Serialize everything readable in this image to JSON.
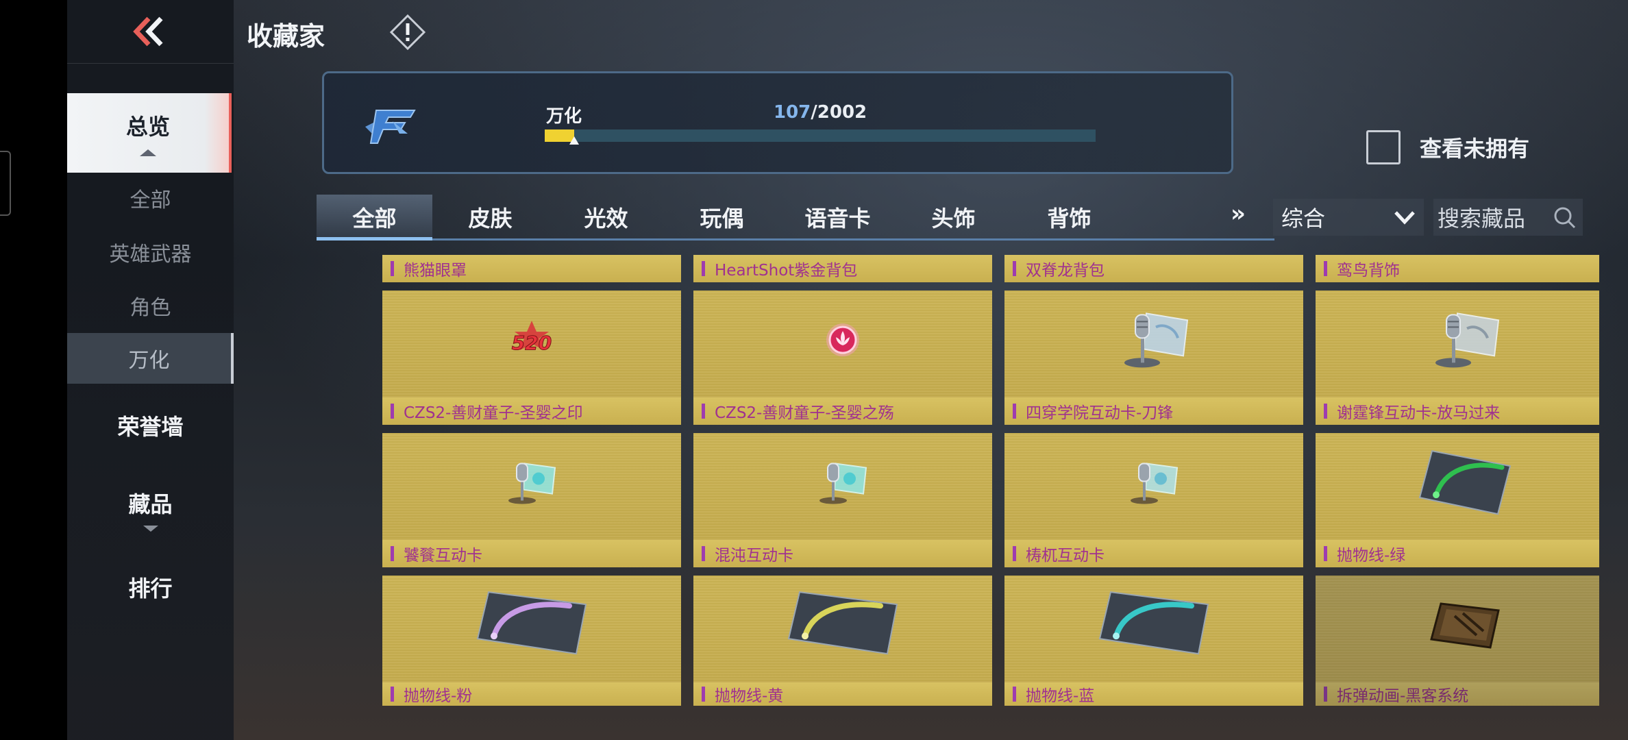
{
  "header": {
    "title": "收藏家"
  },
  "sidebar": {
    "items": [
      {
        "label": "总览"
      },
      {
        "label": "全部"
      },
      {
        "label": "英雄武器"
      },
      {
        "label": "角色"
      },
      {
        "label": "万化"
      },
      {
        "label": "荣誉墙"
      },
      {
        "label": "藏品"
      },
      {
        "label": "排行"
      }
    ]
  },
  "progress": {
    "name": "万化",
    "current": "107",
    "total": "/2002",
    "fraction": 0.053
  },
  "owned_filter": {
    "label": "查看未拥有",
    "checked": false
  },
  "tabs": [
    {
      "label": "全部"
    },
    {
      "label": "皮肤"
    },
    {
      "label": "光效"
    },
    {
      "label": "玩偶"
    },
    {
      "label": "语音卡"
    },
    {
      "label": "头饰"
    },
    {
      "label": "背饰"
    }
  ],
  "more_tabs_label": "»",
  "sort": {
    "value": "综合"
  },
  "search": {
    "placeholder": "搜索藏品"
  },
  "items": [
    {
      "name": "熊猫眼罩"
    },
    {
      "name": "HeartShot紫金背包"
    },
    {
      "name": "双脊龙背包"
    },
    {
      "name": "鸾鸟背饰"
    },
    {
      "name": "CZS2-善财童子-圣婴之印",
      "icon": "520-badge-icon"
    },
    {
      "name": "CZS2-善财童子-圣婴之殇",
      "icon": "lotus-orb-icon"
    },
    {
      "name": "四穿学院互动卡-刀锋",
      "icon": "mic-hologram-card-icon"
    },
    {
      "name": "谢霆锋互动卡-放马过来",
      "icon": "mic-hologram-card-icon"
    },
    {
      "name": "饕餮互动卡",
      "icon": "mic-hologram-card-icon"
    },
    {
      "name": "混沌互动卡",
      "icon": "mic-hologram-card-icon"
    },
    {
      "name": "梼杌互动卡",
      "icon": "mic-hologram-card-icon"
    },
    {
      "name": "抛物线-绿",
      "icon": "parabola-card-icon",
      "color": "#2fbf4f"
    },
    {
      "name": "抛物线-粉",
      "icon": "parabola-card-icon",
      "color": "#c79be6"
    },
    {
      "name": "抛物线-黄",
      "icon": "parabola-card-icon",
      "color": "#d8d45a"
    },
    {
      "name": "抛物线-蓝",
      "icon": "parabola-card-icon",
      "color": "#38c8c8"
    },
    {
      "name": "拆弹动画-黑客系统",
      "icon": "hacker-box-icon"
    }
  ],
  "colors": {
    "accent_red": "#e8605a",
    "progress_yellow": "#f0d231",
    "count_blue": "#85b6ec",
    "card_gold": "#c9b050",
    "item_name": "#a0318f"
  }
}
